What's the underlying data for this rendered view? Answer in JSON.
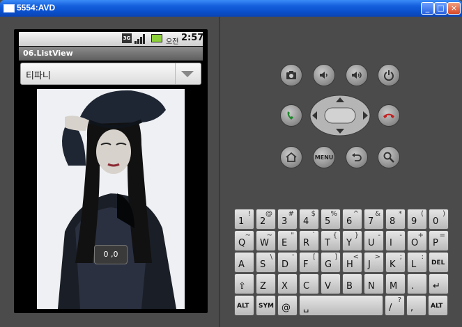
{
  "window": {
    "title": "5554:AVD",
    "minimize": "_",
    "maximize": "□",
    "close": "×"
  },
  "status": {
    "network": "3G",
    "ampm": "오전",
    "time": "2:57"
  },
  "app": {
    "title": "06.ListView"
  },
  "spinner": {
    "selected": "티파니"
  },
  "toast": {
    "text": "0 ,0"
  },
  "controls": {
    "row1": [
      "camera-icon",
      "volume-down-icon",
      "volume-up-icon",
      "power-icon"
    ],
    "call_icons": [
      "call-icon",
      "end-call-icon"
    ],
    "row3": [
      "home-icon",
      "menu-icon",
      "back-icon",
      "search-icon"
    ],
    "menu_label": "MENU"
  },
  "keyboard": {
    "row1": [
      [
        "1",
        "!"
      ],
      [
        "2",
        "@"
      ],
      [
        "3",
        "#"
      ],
      [
        "4",
        "$"
      ],
      [
        "5",
        "%"
      ],
      [
        "6",
        "^"
      ],
      [
        "7",
        "&"
      ],
      [
        "8",
        "*"
      ],
      [
        "9",
        "("
      ],
      [
        "0",
        ")"
      ]
    ],
    "row2": [
      [
        "Q",
        "~"
      ],
      [
        "W",
        "~"
      ],
      [
        "E",
        "\""
      ],
      [
        "R",
        "`"
      ],
      [
        "T",
        "{"
      ],
      [
        "Y",
        "}"
      ],
      [
        "U",
        "-"
      ],
      [
        "I",
        "-"
      ],
      [
        "O",
        "+"
      ],
      [
        "P",
        "="
      ]
    ],
    "row3": [
      [
        "A",
        ""
      ],
      [
        "S",
        "\\"
      ],
      [
        "D",
        "'"
      ],
      [
        "F",
        "["
      ],
      [
        "G",
        "]"
      ],
      [
        "H",
        "<"
      ],
      [
        "J",
        ">"
      ],
      [
        "K",
        ";"
      ],
      [
        "L",
        ":"
      ],
      [
        "DEL",
        ""
      ]
    ],
    "row4": [
      [
        "⇧",
        ""
      ],
      [
        "Z",
        ""
      ],
      [
        "X",
        ""
      ],
      [
        "C",
        ""
      ],
      [
        "V",
        ""
      ],
      [
        "B",
        ""
      ],
      [
        "N",
        ""
      ],
      [
        "M",
        ""
      ],
      [
        ".",
        ""
      ],
      [
        "↵",
        ""
      ]
    ],
    "row5": [
      [
        "ALT",
        ""
      ],
      [
        "SYM",
        ""
      ],
      [
        "@",
        ""
      ],
      [
        "␣",
        ""
      ],
      [
        "/",
        "?"
      ],
      [
        ",",
        ""
      ],
      [
        "ALT",
        ""
      ]
    ]
  }
}
